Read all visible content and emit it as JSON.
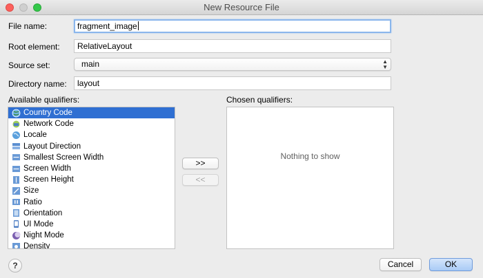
{
  "window": {
    "title": "New Resource File"
  },
  "form": {
    "file_name_label": "File name:",
    "file_name_value": "fragment_image",
    "root_element_label": "Root element:",
    "root_element_value": "RelativeLayout",
    "source_set_label": "Source set:",
    "source_set_value": "main",
    "directory_name_label": "Directory name:",
    "directory_name_value": "layout"
  },
  "available": {
    "label": "Available qualifiers:",
    "items": [
      {
        "label": "Country Code",
        "icon": "globe-flag-icon",
        "selected": true
      },
      {
        "label": "Network Code",
        "icon": "network-icon"
      },
      {
        "label": "Locale",
        "icon": "globe-icon"
      },
      {
        "label": "Layout Direction",
        "icon": "layout-direction-icon"
      },
      {
        "label": "Smallest Screen Width",
        "icon": "screen-width-icon"
      },
      {
        "label": "Screen Width",
        "icon": "screen-width-icon"
      },
      {
        "label": "Screen Height",
        "icon": "screen-height-icon"
      },
      {
        "label": "Size",
        "icon": "size-icon"
      },
      {
        "label": "Ratio",
        "icon": "ratio-icon"
      },
      {
        "label": "Orientation",
        "icon": "orientation-icon"
      },
      {
        "label": "UI Mode",
        "icon": "ui-mode-icon"
      },
      {
        "label": "Night Mode",
        "icon": "night-mode-icon"
      },
      {
        "label": "Density",
        "icon": "density-icon"
      }
    ]
  },
  "chosen": {
    "label": "Chosen qualifiers:",
    "empty_text": "Nothing to show"
  },
  "buttons": {
    "add": ">>",
    "remove": "<<",
    "cancel": "Cancel",
    "ok": "OK",
    "help": "?"
  },
  "colors": {
    "selection": "#2f6fd2",
    "focus_ring": "#8ab6ec",
    "ok_button": "#a9cbf6"
  }
}
